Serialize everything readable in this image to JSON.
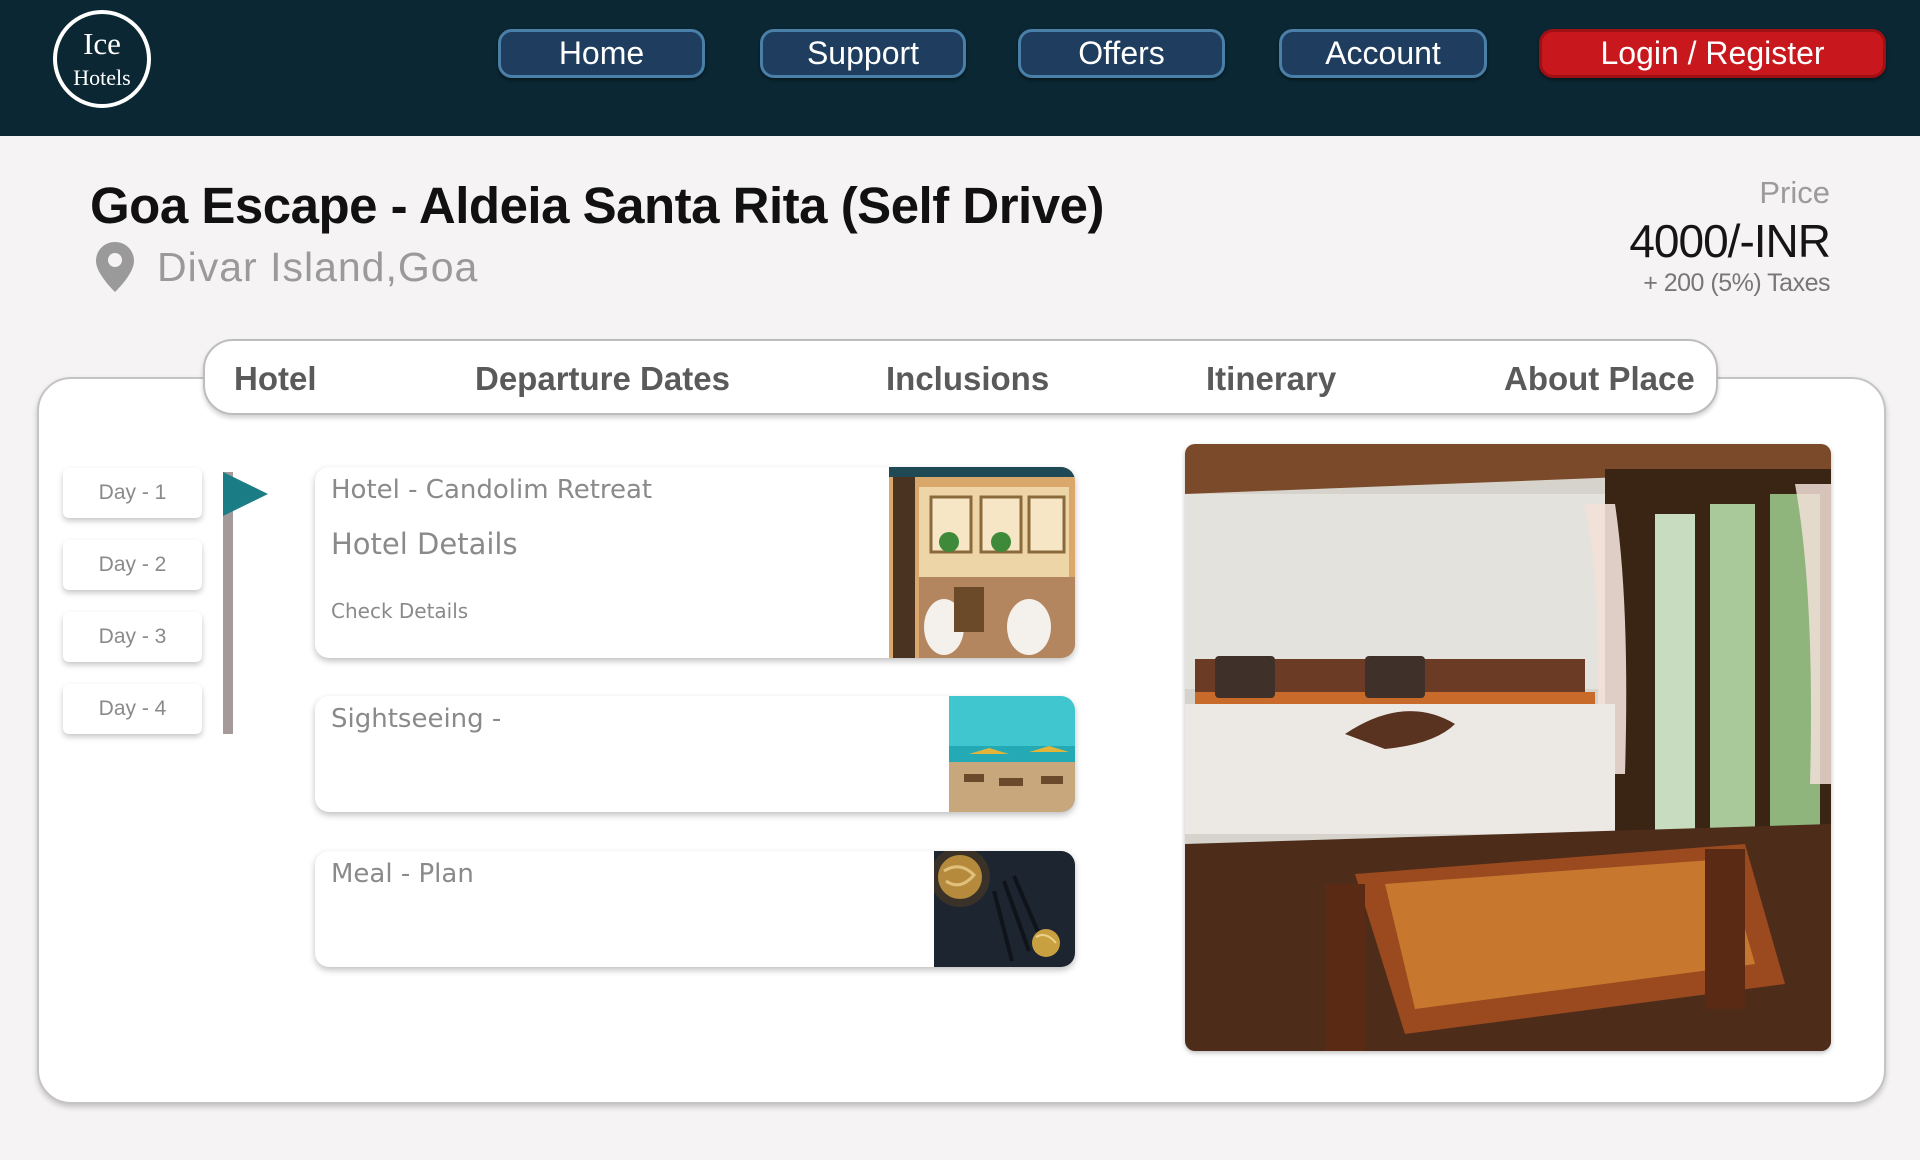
{
  "header": {
    "logo": {
      "line1": "Ice",
      "line2": "Hotels"
    },
    "nav": {
      "home": "Home",
      "support": "Support",
      "offers": "Offers",
      "account": "Account",
      "login": "Login / Register"
    }
  },
  "package": {
    "title": "Goa Escape - Aldeia Santa Rita (Self Drive)",
    "location": "Divar Island,Goa",
    "price_label": "Price",
    "price": "4000/-INR",
    "taxes": "+ 200 (5%) Taxes"
  },
  "tabs": [
    "Hotel",
    "Departure Dates",
    "Inclusions",
    "Itinerary",
    "About Place"
  ],
  "days": [
    "Day - 1",
    "Day - 2",
    "Day - 3",
    "Day - 4"
  ],
  "selected_day": "Day - 1",
  "itinerary": {
    "hotel": {
      "name": "Hotel - Candolim Retreat",
      "details_heading": "Hotel Details",
      "link": "Check Details"
    },
    "sightseeing": {
      "label": "Sightseeing -"
    },
    "meal": {
      "label": "Meal - Plan"
    }
  },
  "colors": {
    "header_bg": "#0b2733",
    "nav_button": "#1e3d5f",
    "login_button": "#c8181d",
    "flag": "#1a7d86"
  }
}
